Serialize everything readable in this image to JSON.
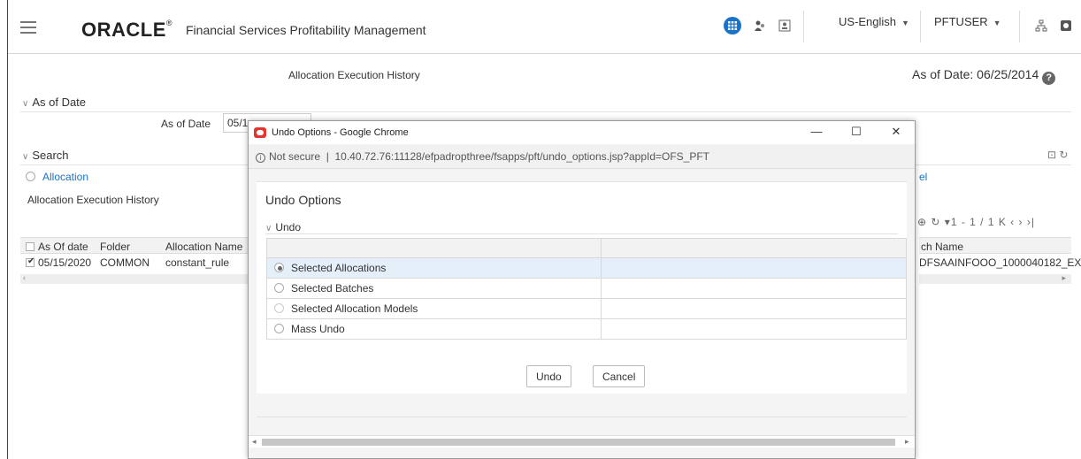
{
  "header": {
    "brand": "ORACLE",
    "brand_mark": "®",
    "product": "Financial Services Profitability Management",
    "language": "US-English",
    "user": "PFTUSER"
  },
  "page": {
    "title": "Allocation Execution History",
    "as_of_date_label": "As of Date:",
    "as_of_date_value": "06/25/2014",
    "help": "?"
  },
  "sections": {
    "as_of_date": "As of Date",
    "as_of_field_label": "As of Date",
    "as_of_field_value": "05/1",
    "search": "Search",
    "allocation_radio": "Allocation",
    "subheading": "Allocation Execution History",
    "right_link": "el"
  },
  "table": {
    "columns": [
      "As Of date",
      "Folder",
      "Allocation Name"
    ],
    "rows": [
      {
        "date": "05/15/2020",
        "folder": "COMMON",
        "name": "constant_rule"
      }
    ],
    "right_header": "ch Name",
    "right_value": "DFSAAINFOOO_1000040182_EX",
    "pager": "1 - 1 / 1"
  },
  "popup": {
    "window_title": "Undo Options - Google Chrome",
    "not_secure": "Not secure",
    "url": "10.40.72.76:11128/efpadropthree/fsapps/pft/undo_options.jsp?appId=OFS_PFT",
    "heading": "Undo Options",
    "section": "Undo",
    "options": [
      {
        "label": "Selected Allocations",
        "selected": true
      },
      {
        "label": "Selected Batches",
        "selected": false
      },
      {
        "label": "Selected Allocation Models",
        "selected": false
      },
      {
        "label": "Mass Undo",
        "selected": false
      }
    ],
    "undo_button": "Undo",
    "cancel_button": "Cancel"
  },
  "colors": {
    "accent": "#1a73c7",
    "selected_row": "#e4effa"
  }
}
